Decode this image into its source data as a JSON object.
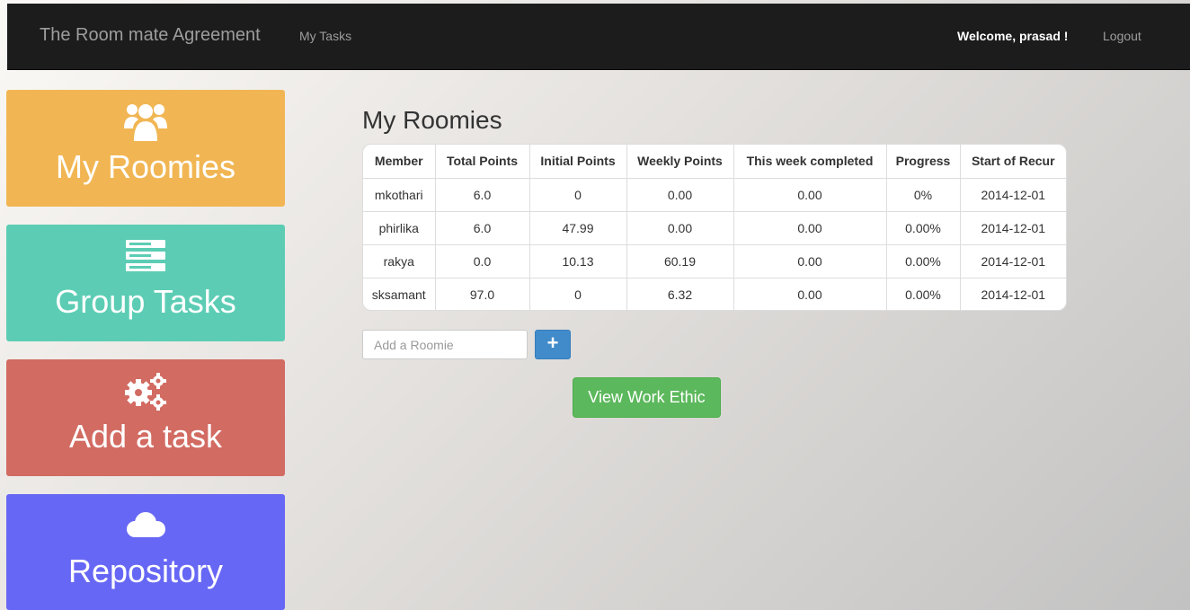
{
  "navbar": {
    "brand": "The Room mate Agreement",
    "my_tasks": "My Tasks",
    "welcome": "Welcome, prasad !",
    "logout": "Logout"
  },
  "sidebar": {
    "items": [
      {
        "label": "My Roomies",
        "icon": "users-icon",
        "color": "#f1b653"
      },
      {
        "label": "Group Tasks",
        "icon": "server-icon",
        "color": "#5ccdb4"
      },
      {
        "label": "Add a task",
        "icon": "gears-icon",
        "color": "#d26b62"
      },
      {
        "label": "Repository",
        "icon": "cloud-icon",
        "color": "#6767f5"
      }
    ]
  },
  "main": {
    "title": "My Roomies",
    "table": {
      "headers": [
        "Member",
        "Total Points",
        "Initial Points",
        "Weekly Points",
        "This week completed",
        "Progress",
        "Start of Recur"
      ],
      "rows": [
        [
          "mkothari",
          "6.0",
          "0",
          "0.00",
          "0.00",
          "0%",
          "2014-12-01"
        ],
        [
          "phirlika",
          "6.0",
          "47.99",
          "0.00",
          "0.00",
          "0.00%",
          "2014-12-01"
        ],
        [
          "rakya",
          "0.0",
          "10.13",
          "60.19",
          "0.00",
          "0.00%",
          "2014-12-01"
        ],
        [
          "sksamant",
          "97.0",
          "0",
          "6.32",
          "0.00",
          "0.00%",
          "2014-12-01"
        ]
      ]
    },
    "add_roomie": {
      "placeholder": "Add a Roomie",
      "button_label": "+"
    },
    "work_ethic_label": "View Work Ethic"
  },
  "colors": {
    "navbar": "#1c1c1c",
    "primary": "#428bca",
    "success": "#5cb85c"
  }
}
